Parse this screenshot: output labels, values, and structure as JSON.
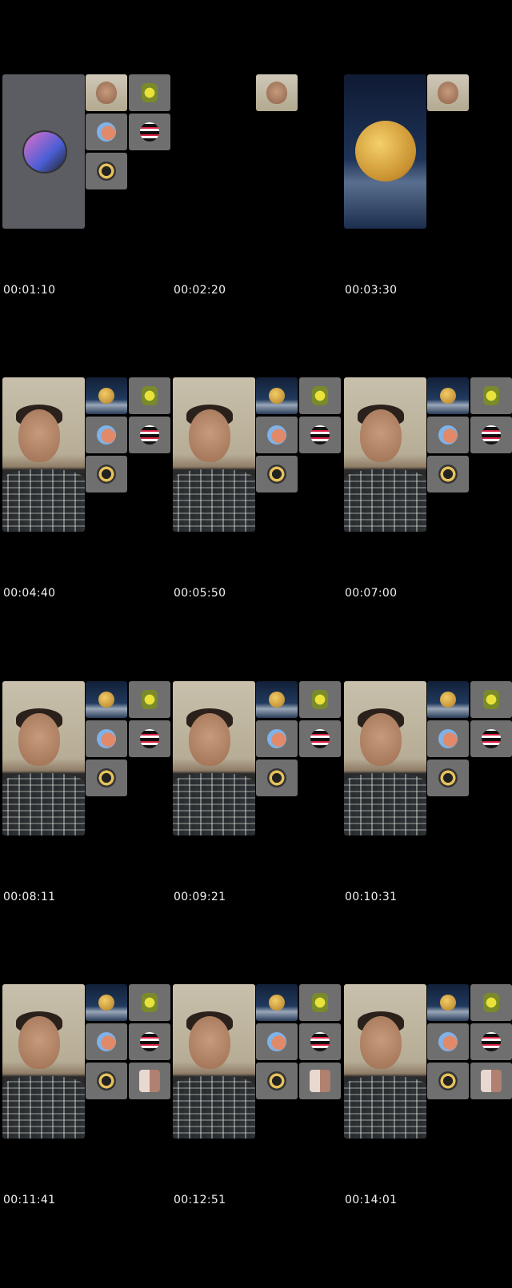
{
  "frames": [
    {
      "timestamp": "00:01:10",
      "main": "avatar",
      "tiles": [
        "face",
        "corn",
        "peach",
        "stripe",
        "coin"
      ]
    },
    {
      "timestamp": "00:02:20",
      "main": "none",
      "tiles": [
        "face"
      ]
    },
    {
      "timestamp": "00:03:30",
      "main": "moon",
      "tiles": [
        "face"
      ]
    },
    {
      "timestamp": "00:04:40",
      "main": "person",
      "tiles": [
        "moon",
        "corn",
        "peach",
        "stripe",
        "coin"
      ]
    },
    {
      "timestamp": "00:05:50",
      "main": "person",
      "tiles": [
        "moon",
        "corn",
        "peach",
        "stripe",
        "coin"
      ]
    },
    {
      "timestamp": "00:07:00",
      "main": "person",
      "tiles": [
        "moon",
        "corn",
        "peach",
        "stripe",
        "coin"
      ]
    },
    {
      "timestamp": "00:08:11",
      "main": "person",
      "tiles": [
        "moon",
        "corn",
        "peach",
        "stripe",
        "coin"
      ]
    },
    {
      "timestamp": "00:09:21",
      "main": "person",
      "tiles": [
        "moon",
        "corn",
        "peach",
        "stripe",
        "coin"
      ]
    },
    {
      "timestamp": "00:10:31",
      "main": "person",
      "tiles": [
        "moon",
        "corn",
        "peach",
        "stripe",
        "coin"
      ]
    },
    {
      "timestamp": "00:11:41",
      "main": "person",
      "tiles": [
        "moon",
        "corn",
        "peach",
        "stripe",
        "coin",
        "couple"
      ]
    },
    {
      "timestamp": "00:12:51",
      "main": "person",
      "tiles": [
        "moon",
        "corn",
        "peach",
        "stripe",
        "coin",
        "couple"
      ]
    },
    {
      "timestamp": "00:14:01",
      "main": "person",
      "tiles": [
        "moon",
        "corn",
        "peach",
        "stripe",
        "coin",
        "couple"
      ]
    }
  ]
}
